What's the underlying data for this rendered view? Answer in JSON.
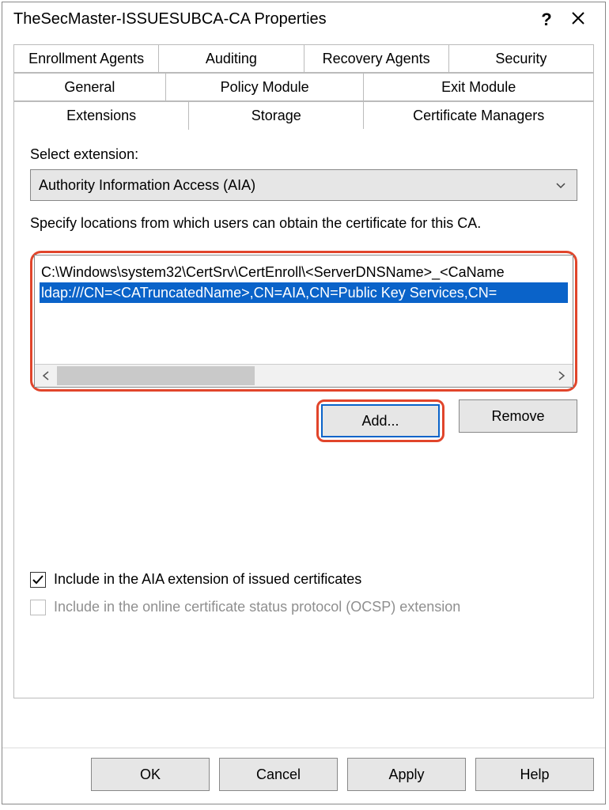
{
  "window": {
    "title": "TheSecMaster-ISSUESUBCA-CA Properties"
  },
  "tabs": {
    "row1": [
      "Enrollment Agents",
      "Auditing",
      "Recovery Agents",
      "Security"
    ],
    "row2": [
      "General",
      "Policy Module",
      "Exit Module"
    ],
    "row3": [
      "Extensions",
      "Storage",
      "Certificate Managers"
    ],
    "active": "Extensions"
  },
  "panel": {
    "select_label": "Select extension:",
    "extension_value": "Authority Information Access (AIA)",
    "description": "Specify locations from which users can obtain the certificate for this CA.",
    "locations": [
      {
        "text": "C:\\Windows\\system32\\CertSrv\\CertEnroll\\<ServerDNSName>_<CaName",
        "selected": false
      },
      {
        "text": "ldap:///CN=<CATruncatedName>,CN=AIA,CN=Public Key Services,CN=",
        "selected": true
      }
    ],
    "add_label": "Add...",
    "remove_label": "Remove",
    "checkbox1": {
      "label": "Include in the AIA extension of issued certificates",
      "checked": true,
      "enabled": true
    },
    "checkbox2": {
      "label": "Include in the online certificate status protocol (OCSP) extension",
      "checked": false,
      "enabled": false
    }
  },
  "buttons": {
    "ok": "OK",
    "cancel": "Cancel",
    "apply": "Apply",
    "help": "Help"
  }
}
